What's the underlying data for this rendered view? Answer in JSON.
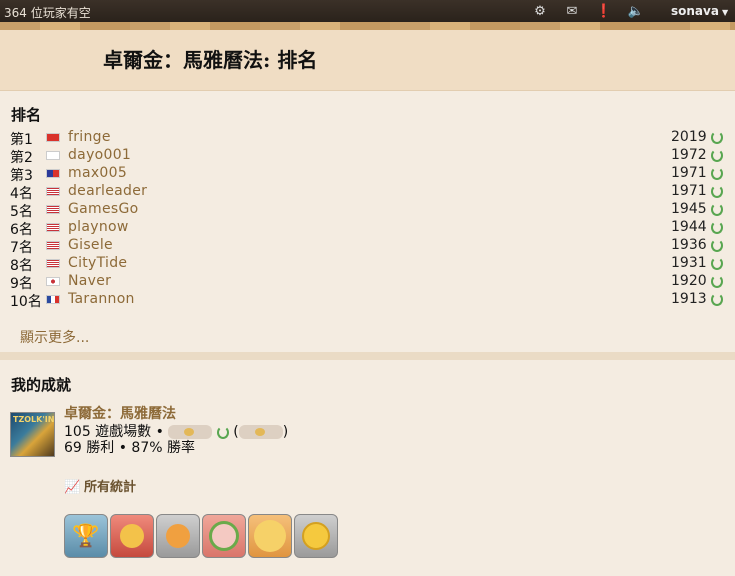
{
  "topbar": {
    "players_online": "364 位玩家有空",
    "icons": [
      "gear-icon",
      "mail-icon",
      "alert-icon",
      "volume-icon"
    ],
    "user": "sonava"
  },
  "header": {
    "title": "卓爾金：馬雅曆法: 排名"
  },
  "ranking": {
    "title": "排名",
    "rows": [
      {
        "pos": "第1",
        "flag": "hk",
        "name": "fringe",
        "elo": "2019"
      },
      {
        "pos": "第2",
        "flag": "jp",
        "name": "dayo001",
        "elo": "1972"
      },
      {
        "pos": "第3",
        "flag": "tw",
        "name": "max005",
        "elo": "1971"
      },
      {
        "pos": "4名",
        "flag": "us",
        "name": "dearleader",
        "elo": "1971"
      },
      {
        "pos": "5名",
        "flag": "us",
        "name": "GamesGo",
        "elo": "1945"
      },
      {
        "pos": "6名",
        "flag": "us",
        "name": "playnow",
        "elo": "1944"
      },
      {
        "pos": "7名",
        "flag": "us",
        "name": "Gisele",
        "elo": "1936"
      },
      {
        "pos": "8名",
        "flag": "us",
        "name": "CityTide",
        "elo": "1931"
      },
      {
        "pos": "9名",
        "flag": "kr",
        "name": "Naver",
        "elo": "1920"
      },
      {
        "pos": "10名",
        "flag": "fr",
        "name": "Tarannon",
        "elo": "1913"
      }
    ],
    "more": "顯示更多..."
  },
  "achievements": {
    "title": "我的成就",
    "game_name": "卓爾金：馬雅曆法",
    "thumb_label": "TZOLK'IN",
    "games_played": "105 遊戲場數 •",
    "open_paren": "(",
    "close_paren": ")",
    "wins_line": "69 勝利 • 87% 勝率",
    "stats_link": "所有統計",
    "awards": [
      "trophy-award",
      "medal-award",
      "ribbon-award",
      "laurel-award",
      "gold-coin-award",
      "gold-medal-award"
    ]
  }
}
